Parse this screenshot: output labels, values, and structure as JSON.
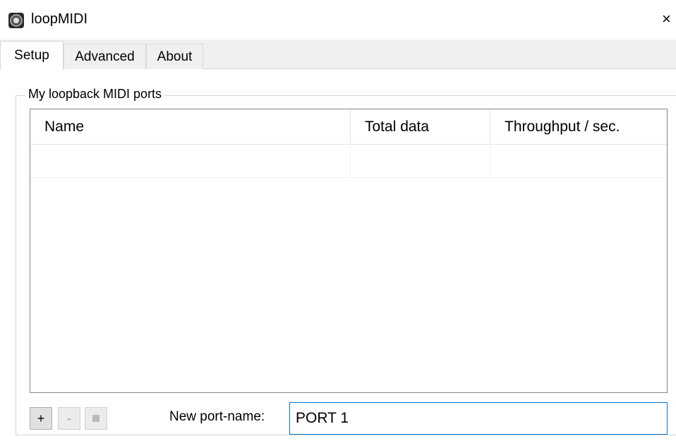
{
  "window": {
    "title": "loopMIDI",
    "icon": "app-logo-icon",
    "close_glyph": "×"
  },
  "tabs": [
    {
      "label": "Setup",
      "active": true
    },
    {
      "label": "Advanced",
      "active": false
    },
    {
      "label": "About",
      "active": false
    }
  ],
  "group": {
    "title": "My loopback MIDI ports"
  },
  "ports_table": {
    "columns": [
      "Name",
      "Total data",
      "Throughput / sec."
    ],
    "rows": []
  },
  "buttons": {
    "add": "+",
    "remove": "-",
    "stop": "stop-icon"
  },
  "new_port": {
    "label": "New port-name:",
    "value": "PORT 1"
  },
  "colors": {
    "accent": "#0078d7",
    "tab_bg": "#f0f0f0"
  }
}
